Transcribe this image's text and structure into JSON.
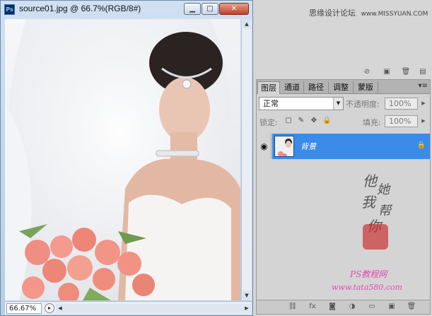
{
  "document": {
    "app_icon": "Ps",
    "title": "source01.jpg @ 66.7%(RGB/8#)",
    "window_buttons": {
      "minimize": "▁",
      "maximize": "□",
      "close": "✕"
    },
    "zoom": "66.67%"
  },
  "watermark_top": {
    "text": "思缘设计论坛",
    "url": "www.MISSYUAN.COM"
  },
  "layers_panel": {
    "tabs": [
      "图层",
      "通道",
      "路径",
      "调整",
      "蒙版"
    ],
    "blend_mode": "正常",
    "opacity_label": "不透明度:",
    "opacity_value": "100%",
    "lock_label": "锁定:",
    "fill_label": "填充:",
    "fill_value": "100%",
    "layer": {
      "name": "背景"
    }
  },
  "signature_chars": [
    "他",
    "她",
    "我",
    "帮",
    "你"
  ],
  "ps_watermark": {
    "line1": "PS教程网",
    "line2": "www.tata580.com"
  },
  "colors": {
    "selection": "#3a8bea",
    "panel_bg": "#d4d4d4",
    "title_gradient_top": "#cfe0f2"
  },
  "icons": {
    "eye": "eye-icon",
    "lock": "lock-icon",
    "panel_menu": "panel-menu-icon"
  }
}
